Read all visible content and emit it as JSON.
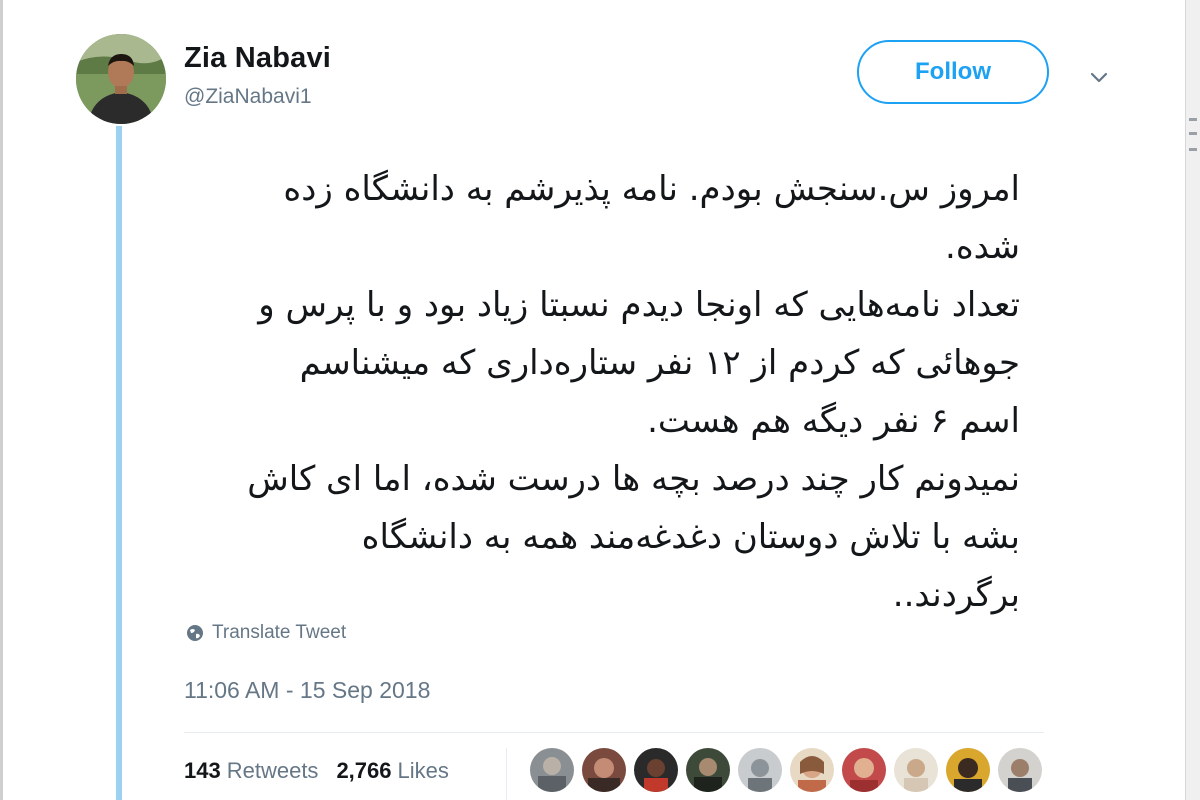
{
  "author": {
    "display_name": "Zia Nabavi",
    "handle": "@ZiaNabavi1"
  },
  "follow_button": {
    "label": "Follow"
  },
  "tweet": {
    "lines": [
      "امروز س.سنجش بودم. نامه پذیرشم به دانشگاه زده",
      "شده.",
      "تعداد نامه‌هایی که اونجا دیدم نسبتا زیاد بود و با پرس و",
      "جوهائی که کردم از ۱۲ نفر ستاره‌داری که میشناسم",
      "اسم ۶ نفر دیگه هم هست.",
      "نمیدونم کار چند درصد بچه ها درست شده، اما ای کاش",
      "بشه با تلاش دوستان دغدغه‌مند همه به دانشگاه",
      "برگردند.."
    ]
  },
  "translate_label": "Translate Tweet",
  "timestamp": "11:06 AM - 15 Sep 2018",
  "stats": {
    "retweets_count": "143",
    "retweets_label": "Retweets",
    "likes_count": "2,766",
    "likes_label": "Likes"
  },
  "colors": {
    "accent": "#1da1f2",
    "thread_line": "#9dd1f2",
    "secondary_text": "#657786",
    "primary_text": "#14171a"
  },
  "icons": {
    "translate": "globe-icon",
    "menu": "chevron-down-icon"
  }
}
